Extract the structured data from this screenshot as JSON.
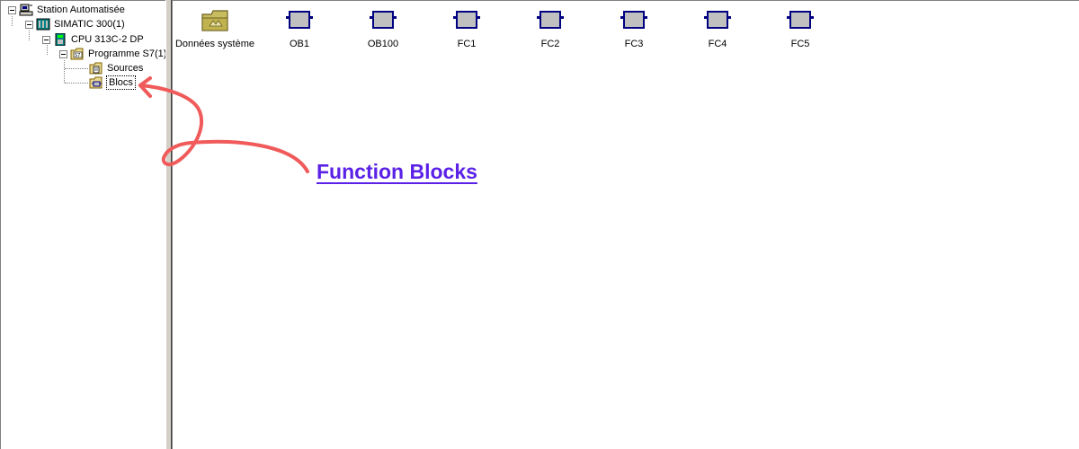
{
  "tree": {
    "nodes": [
      {
        "label": "Station Automatisée",
        "icon": "station-icon"
      },
      {
        "label": "SIMATIC 300(1)",
        "icon": "rack-icon"
      },
      {
        "label": "CPU 313C-2 DP",
        "icon": "cpu-icon"
      },
      {
        "label": "Programme S7(1)",
        "icon": "s7-program-icon"
      },
      {
        "label": "Sources",
        "icon": "sources-folder-icon"
      },
      {
        "label": "Blocs",
        "icon": "blocks-folder-icon",
        "selected": true
      }
    ]
  },
  "content": {
    "items": [
      {
        "label": "Données système",
        "icon": "system-data-icon"
      },
      {
        "label": "OB1",
        "icon": "block-icon"
      },
      {
        "label": "OB100",
        "icon": "block-icon"
      },
      {
        "label": "FC1",
        "icon": "block-icon"
      },
      {
        "label": "FC2",
        "icon": "block-icon"
      },
      {
        "label": "FC3",
        "icon": "block-icon"
      },
      {
        "label": "FC4",
        "icon": "block-icon"
      },
      {
        "label": "FC5",
        "icon": "block-icon"
      }
    ]
  },
  "annotation": {
    "text": "Function Blocks",
    "text_color": "#5b21e6",
    "arrow_color": "#f05a5a"
  }
}
